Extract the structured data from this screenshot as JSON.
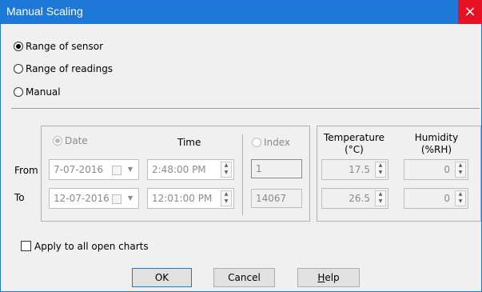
{
  "window": {
    "title": "Manual Scaling",
    "close_glyph": "×"
  },
  "scale_options": {
    "range_of_sensor": "Range of sensor",
    "range_of_readings": "Range of readings",
    "manual": "Manual",
    "selected": "range_of_sensor"
  },
  "range": {
    "date_label": "Date",
    "time_label": "Time",
    "index_label": "Index",
    "temperature_label_1": "Temperature",
    "temperature_label_2": "(°C)",
    "humidity_label_1": "Humidity",
    "humidity_label_2": "(%RH)",
    "from_label": "From",
    "to_label": "To",
    "from": {
      "date": "7-07-2016",
      "time": "2:48:00 PM",
      "index": "1",
      "temperature": "17.5",
      "humidity": "0"
    },
    "to": {
      "date": "12-07-2016",
      "time": "12:01:00 PM",
      "index": "14067",
      "temperature": "26.5",
      "humidity": "0"
    }
  },
  "apply_all_label": "Apply to all open charts",
  "buttons": {
    "ok": "OK",
    "cancel": "Cancel",
    "help_prefix": "H",
    "help_rest": "elp"
  },
  "colors": {
    "titlebar": "#1e78d7",
    "close": "#e81123"
  }
}
